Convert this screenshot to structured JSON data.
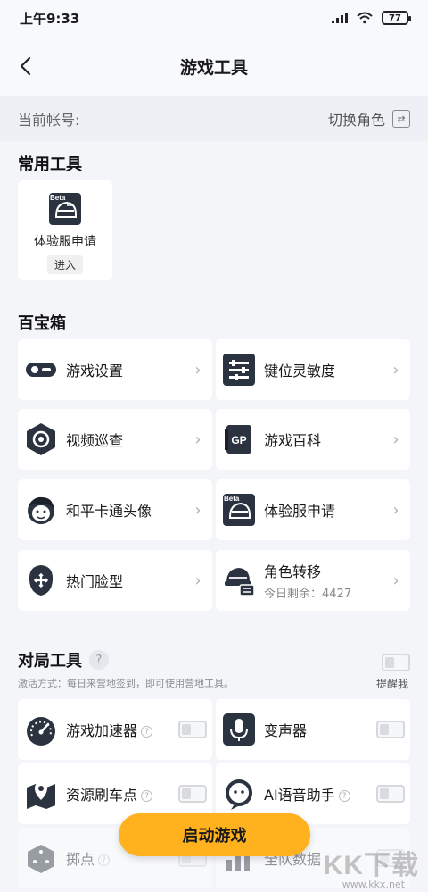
{
  "status_bar": {
    "time": "上午9:33",
    "battery": "77"
  },
  "header": {
    "title": "游戏工具"
  },
  "account": {
    "label": "当前帐号:",
    "switch_label": "切换角色",
    "switch_icon": "swap-icon"
  },
  "common_tools": {
    "title": "常用工具",
    "item": {
      "label": "体验服申请",
      "action": "进入",
      "badge": "Beta",
      "icon": "beta-server-icon"
    }
  },
  "toolbox": {
    "title": "百宝箱",
    "items": [
      {
        "label": "游戏设置",
        "icon": "game-settings-icon"
      },
      {
        "label": "键位灵敏度",
        "icon": "sliders-icon"
      },
      {
        "label": "视频巡查",
        "icon": "video-patrol-icon"
      },
      {
        "label": "游戏百科",
        "icon": "gp-wiki-icon",
        "icon_text": "GP"
      },
      {
        "label": "和平卡通头像",
        "icon": "cartoon-avatar-icon"
      },
      {
        "label": "体验服申请",
        "icon": "beta-server-icon",
        "badge": "Beta"
      },
      {
        "label": "热门脸型",
        "icon": "face-shape-icon"
      },
      {
        "label": "角色转移",
        "sub": "今日剩余：4427",
        "icon": "role-transfer-icon"
      }
    ]
  },
  "battle_tools": {
    "title": "对局工具",
    "hint": "激活方式：每日来营地签到，即可使用营地工具。",
    "remind_label": "提醒我",
    "items": [
      {
        "label": "游戏加速器",
        "icon": "speedometer-icon",
        "help": true
      },
      {
        "label": "变声器",
        "icon": "voice-changer-icon",
        "help": false
      },
      {
        "label": "资源刷车点",
        "icon": "map-pin-icon",
        "help": true
      },
      {
        "label": "AI语音助手",
        "icon": "ai-voice-icon",
        "help": true
      },
      {
        "label": "掷点",
        "icon": "dice-icon",
        "help": true
      },
      {
        "label": "全队数据",
        "icon": "team-data-icon",
        "help": false
      }
    ]
  },
  "footer": {
    "start_button": "启动游戏",
    "watermark": "KK下载",
    "watermark_url": "www.kkx.net"
  },
  "colors": {
    "accent": "#ffb21e",
    "icon_dark": "#2b3340",
    "background": "#f3f5f8"
  }
}
